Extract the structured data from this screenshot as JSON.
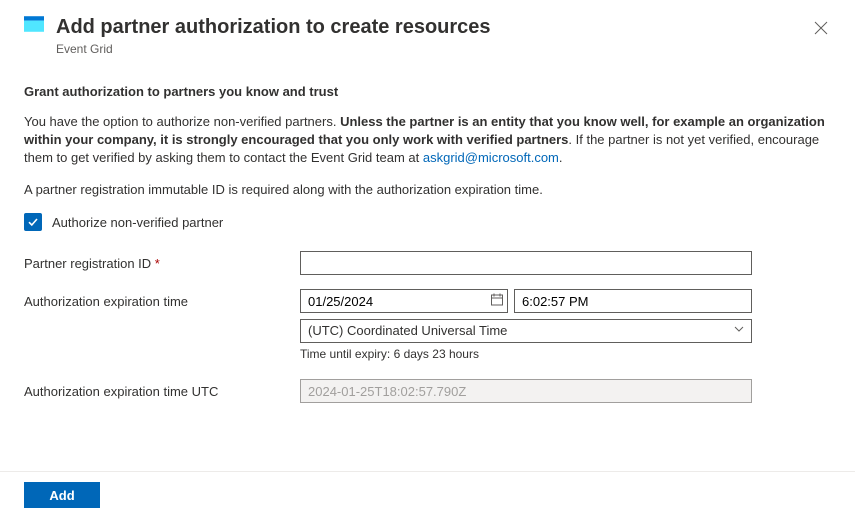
{
  "header": {
    "title": "Add partner authorization to create resources",
    "service": "Event Grid"
  },
  "section": {
    "heading": "Grant authorization to partners you know and trust",
    "intro_lead": "You have the option to authorize non-verified partners. ",
    "intro_bold": "Unless the partner is an entity that you know well, for example an organization within your company, it is strongly encouraged that you only work with verified partners",
    "intro_tail": ". If the partner is not yet verified, encourage them to get verified by asking them to contact the Event Grid team at ",
    "email_link": "askgrid@microsoft.com",
    "intro_period": ".",
    "requirement_text": "A partner registration immutable ID is required along with the authorization expiration time."
  },
  "checkbox": {
    "label": "Authorize non-verified partner",
    "checked": true
  },
  "fields": {
    "registration_id": {
      "label": "Partner registration ID",
      "required_mark": "*",
      "value": ""
    },
    "expiration": {
      "label": "Authorization expiration time",
      "date_value": "01/25/2024",
      "time_value": "6:02:57 PM",
      "timezone_selected": "(UTC) Coordinated Universal Time",
      "helper_text": "Time until expiry: 6 days 23 hours"
    },
    "expiration_utc": {
      "label": "Authorization expiration time UTC",
      "value": "2024-01-25T18:02:57.790Z"
    }
  },
  "footer": {
    "primary_label": "Add"
  }
}
